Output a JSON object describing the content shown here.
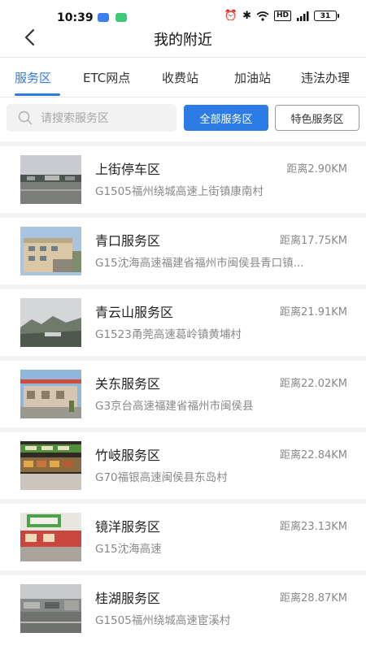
{
  "status_bar": {
    "time": "10:39",
    "battery": "31",
    "network": "HD"
  },
  "header": {
    "title": "我的附近"
  },
  "tabs": [
    {
      "label": "服务区",
      "active": true
    },
    {
      "label": "ETC网点",
      "active": false
    },
    {
      "label": "收费站",
      "active": false
    },
    {
      "label": "加油站",
      "active": false
    },
    {
      "label": "违法办理",
      "active": false
    }
  ],
  "search": {
    "placeholder": "请搜索服务区"
  },
  "filters": {
    "all_label": "全部服务区",
    "special_label": "特色服务区"
  },
  "colors": {
    "accent": "#2d7be5",
    "secondary_text": "#888888",
    "list_background": "#f2f3f5"
  },
  "items": [
    {
      "name": "上街停车区",
      "distance": "距离2.90KM",
      "address": "G1505福州绕城高速上街镇康南村",
      "thumb": "parking-area-photo"
    },
    {
      "name": "青口服务区",
      "distance": "距离17.75KM",
      "address": "G15沈海高速福建省福州市闽侯县青口镇...",
      "thumb": "service-building-photo"
    },
    {
      "name": "青云山服务区",
      "distance": "距离21.91KM",
      "address": "G1523甬莞高速葛岭镇黄埔村",
      "thumb": "mountain-view-photo"
    },
    {
      "name": "关东服务区",
      "distance": "距离22.02KM",
      "address": "G3京台高速福建省福州市闽侯县",
      "thumb": "service-plaza-photo"
    },
    {
      "name": "竹岐服务区",
      "distance": "距离22.84KM",
      "address": "G70福银高速闽侯县东岛村",
      "thumb": "food-counter-photo"
    },
    {
      "name": "镜洋服务区",
      "distance": "距离23.13KM",
      "address": "G15沈海高速",
      "thumb": "service-sign-photo"
    },
    {
      "name": "桂湖服务区",
      "distance": "距离28.87KM",
      "address": "G1505福州绕城高速宦溪村",
      "thumb": "rest-area-photo"
    }
  ]
}
